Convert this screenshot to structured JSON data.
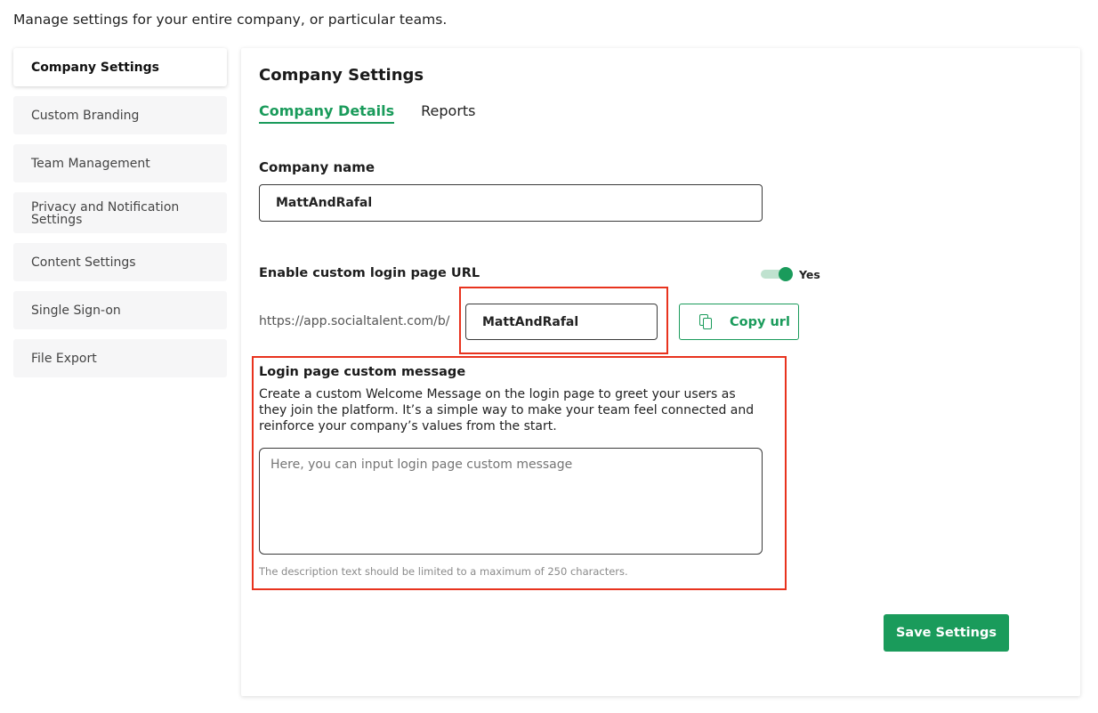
{
  "intro": "Manage settings for your entire company, or particular teams.",
  "sidebar": {
    "items": [
      {
        "label": "Company Settings"
      },
      {
        "label": "Custom Branding"
      },
      {
        "label": "Team Management"
      },
      {
        "label": "Privacy and Notification Settings"
      },
      {
        "label": "Content Settings"
      },
      {
        "label": "Single Sign-on"
      },
      {
        "label": "File Export"
      }
    ]
  },
  "main": {
    "title": "Company Settings",
    "tabs": [
      {
        "label": "Company Details"
      },
      {
        "label": "Reports"
      }
    ],
    "company_name": {
      "label": "Company name",
      "value": "MattAndRafal"
    },
    "custom_login": {
      "label": "Enable custom login page URL",
      "toggle_state": "Yes",
      "url_prefix": "https://app.socialtalent.com/b/",
      "slug_value": "MattAndRafal",
      "copy_label": "Copy url"
    },
    "login_message": {
      "title": "Login page custom message",
      "description": "Create a custom Welcome Message on the login page to greet your users as they join the platform. It’s a simple way to make your team feel connected and reinforce your company’s values from the start.",
      "placeholder": "Here, you can input login page custom message",
      "hint": "The description text should be limited to a maximum of 250 characters."
    },
    "save_label": "Save Settings"
  },
  "colors": {
    "accent": "#1a9b5b",
    "highlight": "#e8331e"
  },
  "icons": {
    "copy": "copy-icon"
  }
}
